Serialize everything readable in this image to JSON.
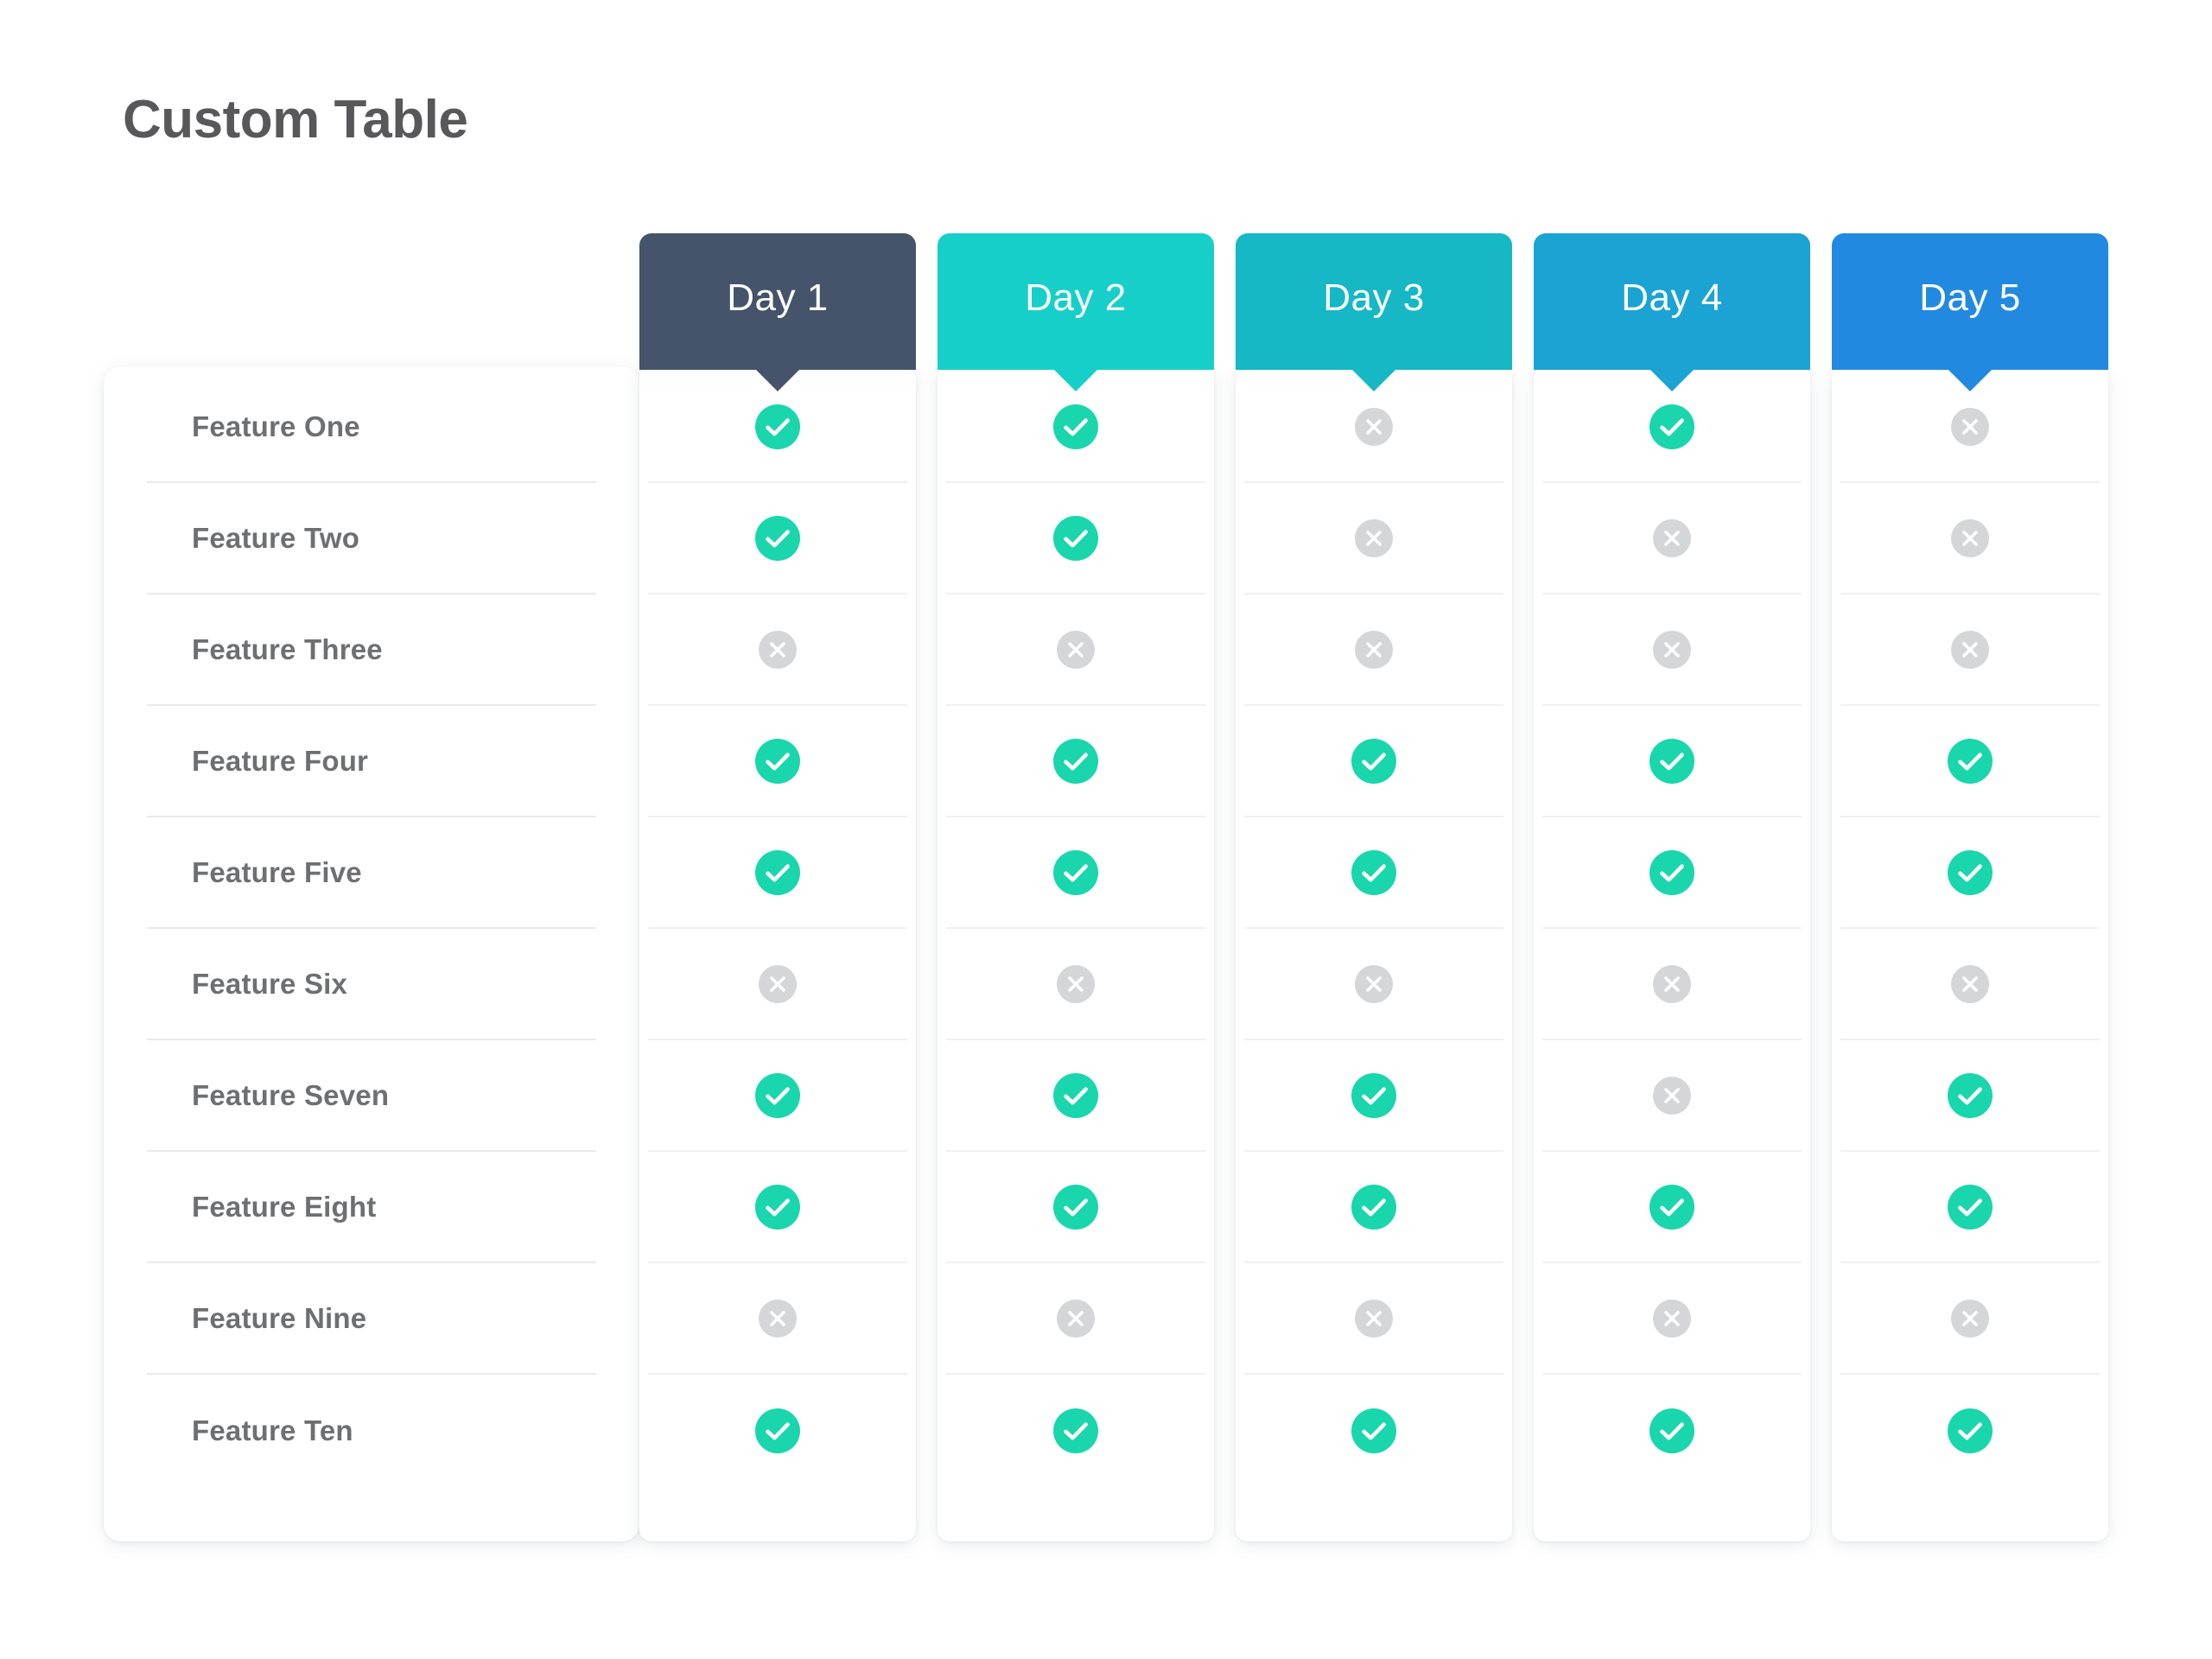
{
  "page": {
    "title": "Custom Table",
    "background": "#ffffff",
    "title_color": "#58585a"
  },
  "colors": {
    "check_fill": "#19d6ad",
    "cross_fill": "#d4d6d8",
    "glyph": "#ffffff",
    "divider": "#e9eaec",
    "card_bg": "#ffffff",
    "label_text": "#6e6f71"
  },
  "columns": [
    {
      "label": "Day 1",
      "color": "#45546b"
    },
    {
      "label": "Day 2",
      "color": "#17cfc9"
    },
    {
      "label": "Day 3",
      "color": "#15b8c4"
    },
    {
      "label": "Day 4",
      "color": "#1ba3d4"
    },
    {
      "label": "Day 5",
      "color": "#2289e0"
    }
  ],
  "rows": [
    {
      "label": "Feature One",
      "values": [
        "check",
        "check",
        "cross",
        "check",
        "cross"
      ]
    },
    {
      "label": "Feature Two",
      "values": [
        "check",
        "check",
        "cross",
        "cross",
        "cross"
      ]
    },
    {
      "label": "Feature Three",
      "values": [
        "cross",
        "cross",
        "cross",
        "cross",
        "cross"
      ]
    },
    {
      "label": "Feature Four",
      "values": [
        "check",
        "check",
        "check",
        "check",
        "check"
      ]
    },
    {
      "label": "Feature Five",
      "values": [
        "check",
        "check",
        "check",
        "check",
        "check"
      ]
    },
    {
      "label": "Feature Six",
      "values": [
        "cross",
        "cross",
        "cross",
        "cross",
        "cross"
      ]
    },
    {
      "label": "Feature Seven",
      "values": [
        "check",
        "check",
        "check",
        "cross",
        "check"
      ]
    },
    {
      "label": "Feature Eight",
      "values": [
        "check",
        "check",
        "check",
        "check",
        "check"
      ]
    },
    {
      "label": "Feature Nine",
      "values": [
        "cross",
        "cross",
        "cross",
        "cross",
        "cross"
      ]
    },
    {
      "label": "Feature Ten",
      "values": [
        "check",
        "check",
        "check",
        "check",
        "check"
      ]
    }
  ],
  "icons": {
    "check": "check-circle-icon",
    "cross": "cross-circle-icon"
  },
  "layout": {
    "column_left_positions": [
      740,
      1085,
      1430,
      1775,
      2120
    ]
  }
}
